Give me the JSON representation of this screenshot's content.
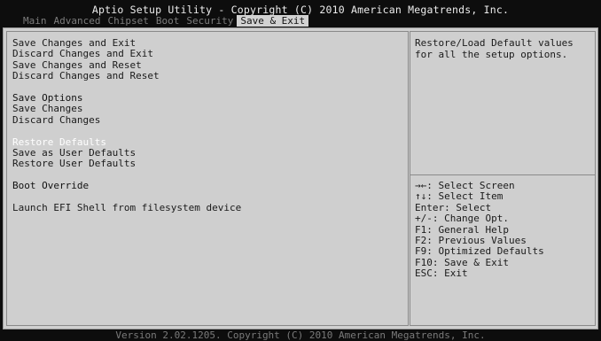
{
  "header": {
    "title": "Aptio Setup Utility - Copyright (C) 2010 American Megatrends, Inc.",
    "tabs": [
      "Main",
      "Advanced",
      "Chipset",
      "Boot",
      "Security",
      "Save & Exit"
    ],
    "active_tab": "Save & Exit"
  },
  "menu": {
    "save_changes_and_exit": "Save Changes and Exit",
    "discard_changes_and_exit": "Discard Changes and Exit",
    "save_changes_and_reset": "Save Changes and Reset",
    "discard_changes_and_reset": "Discard Changes and Reset",
    "save_options_heading": "Save Options",
    "save_changes": "Save Changes",
    "discard_changes": "Discard Changes",
    "restore_defaults": "Restore Defaults",
    "save_as_user_defaults": "Save as User Defaults",
    "restore_user_defaults": "Restore User Defaults",
    "boot_override_heading": "Boot Override",
    "launch_efi_shell": "Launch EFI Shell from filesystem device"
  },
  "help": {
    "description": "Restore/Load Default values\nfor all the setup options."
  },
  "keys": [
    "→←: Select Screen",
    "↑↓: Select Item",
    "Enter: Select",
    "+/-: Change Opt.",
    "F1: General Help",
    "F2: Previous Values",
    "F9: Optimized Defaults",
    "F10: Save & Exit",
    "ESC: Exit"
  ],
  "footer": {
    "version": "Version 2.02.1205. Copyright (C) 2010 American Megatrends, Inc."
  },
  "colors": {
    "background": "#0d0d0d",
    "panel": "#cfcfcf",
    "active_tab": "#d2d2d2",
    "highlight_text": "#ffffff"
  }
}
